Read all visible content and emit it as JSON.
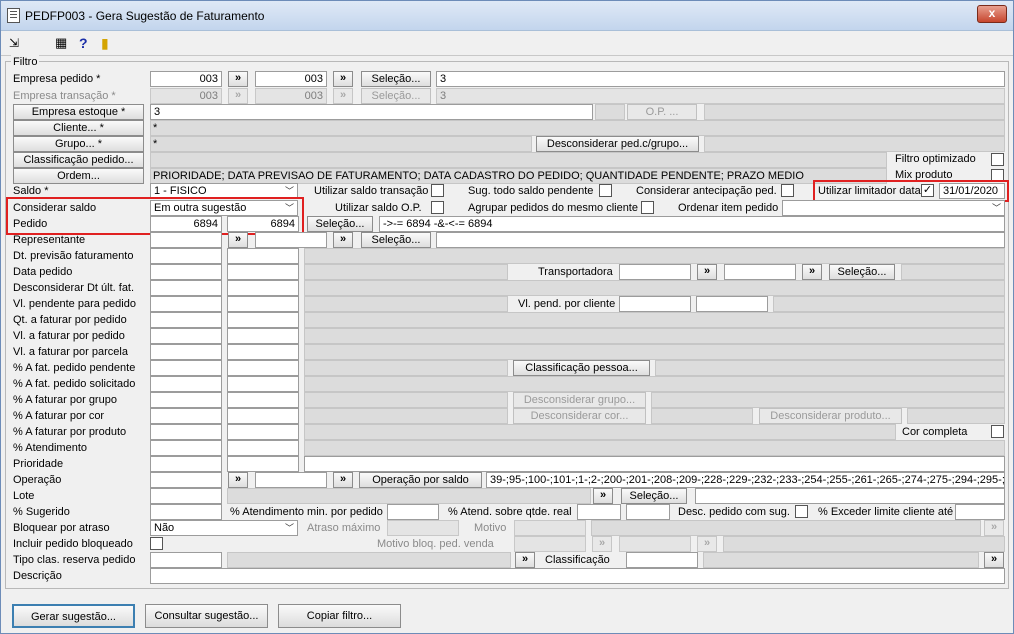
{
  "window": {
    "title": "PEDFP003 - Gera Sugestão de Faturamento",
    "close": "x"
  },
  "toolbar": {
    "help": "?"
  },
  "group": {
    "title": "Filtro"
  },
  "labels": {
    "empresa_pedido": "Empresa pedido *",
    "empresa_transacao": "Empresa transação *",
    "saldo": "Saldo *",
    "considerar_saldo": "Considerar saldo",
    "pedido": "Pedido",
    "representante": "Representante",
    "dt_prev": "Dt. previsão faturamento",
    "data_pedido": "Data pedido",
    "desconsiderar_dt": "Desconsiderar Dt últ. fat.",
    "vl_pendente": "Vl. pendente para pedido",
    "qt_faturar": "Qt. a faturar por pedido",
    "vl_faturar_pedido": "Vl. a faturar por pedido",
    "vl_faturar_parcela": "Vl. a faturar por parcela",
    "pct_fat_pendente": "% A fat. pedido pendente",
    "pct_fat_solicitado": "% A fat. pedido solicitado",
    "pct_faturar_grupo": "% A faturar por grupo",
    "pct_faturar_cor": "% A faturar por cor",
    "pct_faturar_produto": "% A faturar por produto",
    "pct_atendimento": "% Atendimento",
    "prioridade": "Prioridade",
    "operacao": "Operação",
    "lote": "Lote",
    "pct_sugerido": "% Sugerido",
    "bloquear_atraso": "Bloquear por atraso",
    "incluir_bloqueado": "Incluir pedido bloqueado",
    "tipo_clas": "Tipo clas. reserva pedido",
    "descricao": "Descrição",
    "filtro_optimizado": "Filtro optimizado",
    "mix_produto": "Mix produto",
    "utilizar_saldo_transacao": "Utilizar saldo transação",
    "sug_todo_saldo": "Sug. todo saldo pendente",
    "considerar_antecipacao": "Considerar antecipação ped.",
    "utilizar_limitador": "Utilizar limitador data",
    "utilizar_saldo_op": "Utilizar saldo O.P.",
    "agrupar_pedidos": "Agrupar pedidos do mesmo cliente",
    "ordenar_item": "Ordenar item pedido",
    "transportadora": "Transportadora",
    "vl_pend_cliente": "Vl. pend. por cliente",
    "cor_completa": "Cor completa",
    "pct_atend_min": "% Atendimento min. por pedido",
    "pct_atend_sobre": "% Atend. sobre qtde. real",
    "desc_pedido_sug": "Desc. pedido com sug.",
    "pct_exceder": "% Exceder limite cliente até",
    "atraso_maximo": "Atraso máximo",
    "motivo": "Motivo",
    "motivo_bloq": "Motivo bloq. ped. venda",
    "classificacao": "Classificação"
  },
  "buttons": {
    "selecao": "Seleção...",
    "empresa_estoque": "Empresa estoque *",
    "cliente": "Cliente... *",
    "grupo": "Grupo... *",
    "classificacao_pedido": "Classificação pedido...",
    "ordem": "Ordem...",
    "op": "O.P. ...",
    "desconsiderar_ped": "Desconsiderar ped.c/grupo...",
    "classificacao_pessoa": "Classificação pessoa...",
    "desconsiderar_grupo": "Desconsiderar grupo...",
    "desconsiderar_cor": "Desconsiderar cor...",
    "desconsiderar_produto": "Desconsiderar produto...",
    "operacao_saldo": "Operação por saldo",
    "arrow": "»",
    "gerar": "Gerar sugestão...",
    "consultar": "Consultar sugestão...",
    "copiar": "Copiar filtro..."
  },
  "values": {
    "empresa_pedido_de": "003",
    "empresa_pedido_ate": "003",
    "empresa_pedido_desc": "3",
    "empresa_trans_de": "003",
    "empresa_trans_ate": "003",
    "empresa_trans_desc": "3",
    "empresa_estoque": "3",
    "cliente": "*",
    "grupo": "*",
    "ordem": "PRIORIDADE; DATA PREVISAO DE FATURAMENTO; DATA CADASTRO DO PEDIDO; QUANTIDADE PENDENTE; PRAZO MEDIO",
    "saldo": "1 - FISICO",
    "considerar_saldo": "Em outra sugestão",
    "pedido_de": "6894",
    "pedido_ate": "6894",
    "pedido_expr": "->-= 6894 -&-<-= 6894",
    "data_limite": "31/01/2020",
    "operacao_list": "39-;95-;100-;101-;1-;2-;200-;201-;208-;209-;228-;229-;232-;233-;254-;255-;261-;265-;274-;275-;294-;295-;",
    "bloquear_atraso": "Não",
    "check": "✓"
  }
}
